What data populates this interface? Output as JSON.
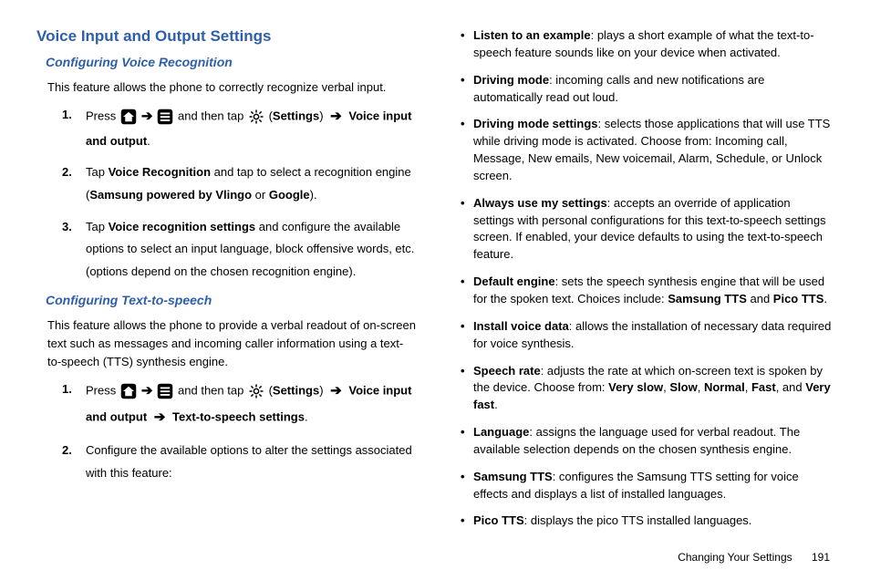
{
  "left": {
    "h1": "Voice Input and Output Settings",
    "section1": {
      "h2": "Configuring Voice Recognition",
      "intro": "This feature allows the phone to correctly recognize verbal input.",
      "steps": {
        "s1": {
          "num": "1.",
          "pre": "Press ",
          "mid": " and then tap ",
          "op": "(",
          "settings": "Settings",
          "cp": ") ",
          "voice": "Voice input and output",
          "period": "."
        },
        "s2": {
          "num": "2.",
          "t1": "Tap ",
          "b1": "Voice Recognition",
          "t2": " and tap to select a recognition engine (",
          "b2": "Samsung powered by Vlingo",
          "t3": " or ",
          "b3": "Google",
          "t4": ")."
        },
        "s3": {
          "num": "3.",
          "t1": "Tap ",
          "b1": "Voice recognition settings",
          "t2": " and configure the available options to select an input language, block offensive words, etc. (options depend on the chosen recognition engine)."
        }
      }
    },
    "section2": {
      "h2": "Configuring Text-to-speech",
      "intro": "This feature allows the phone to provide a verbal readout of on-screen text such as messages and incoming caller information using a text-to-speech (TTS) synthesis engine.",
      "steps": {
        "s1": {
          "num": "1.",
          "pre": "Press ",
          "mid": " and then tap ",
          "op": "(",
          "settings": "Settings",
          "cp": ") ",
          "voice": "Voice input and output",
          "tts": "Text-to-speech settings",
          "period": "."
        },
        "s2": {
          "num": "2.",
          "t1": "Configure the available options to alter the settings associated with this feature:"
        }
      }
    }
  },
  "right": {
    "items": {
      "i0": {
        "b": "Listen to an example",
        "t": ": plays a short example of what the text-to-speech feature sounds like on your device when activated."
      },
      "i1": {
        "b": "Driving mode",
        "t": ": incoming calls and new notifications are automatically read out loud."
      },
      "i2": {
        "b": "Driving mode settings",
        "t": ": selects those applications that will use TTS while driving mode is activated. Choose from: Incoming call, Message, New emails, New voicemail, Alarm, Schedule, or Unlock screen."
      },
      "i3": {
        "b": "Always use my settings",
        "t": ": accepts an override of application settings with personal configurations for this text-to-speech settings screen. If enabled, your device defaults to using the text-to-speech feature."
      },
      "i4": {
        "b": "Default engine",
        "t1": ": sets the speech synthesis engine that will be used for the spoken text. Choices include: ",
        "b2": "Samsung TTS",
        "t2": " and ",
        "b3": "Pico TTS",
        "t3": "."
      },
      "i5": {
        "b": "Install voice data",
        "t": ": allows the installation of necessary data required for voice synthesis."
      },
      "i6": {
        "b": "Speech rate",
        "t1": ": adjusts the rate at which on-screen text is spoken by the device. Choose from: ",
        "b2": "Very slow",
        "c1": ", ",
        "b3": "Slow",
        "c2": ", ",
        "b4": "Normal",
        "c3": ", ",
        "b5": "Fast",
        "c4": ", and ",
        "b6": "Very fast",
        "t2": "."
      },
      "i7": {
        "b": "Language",
        "t": ": assigns the language used for verbal readout. The available selection depends on the chosen synthesis engine."
      },
      "i8": {
        "b": "Samsung TTS",
        "t": ": configures the Samsung TTS setting for voice effects and displays a list of installed languages."
      },
      "i9": {
        "b": "Pico TTS",
        "t": ": displays the pico TTS installed languages."
      }
    }
  },
  "footer": {
    "section": "Changing Your Settings",
    "page": "191"
  }
}
